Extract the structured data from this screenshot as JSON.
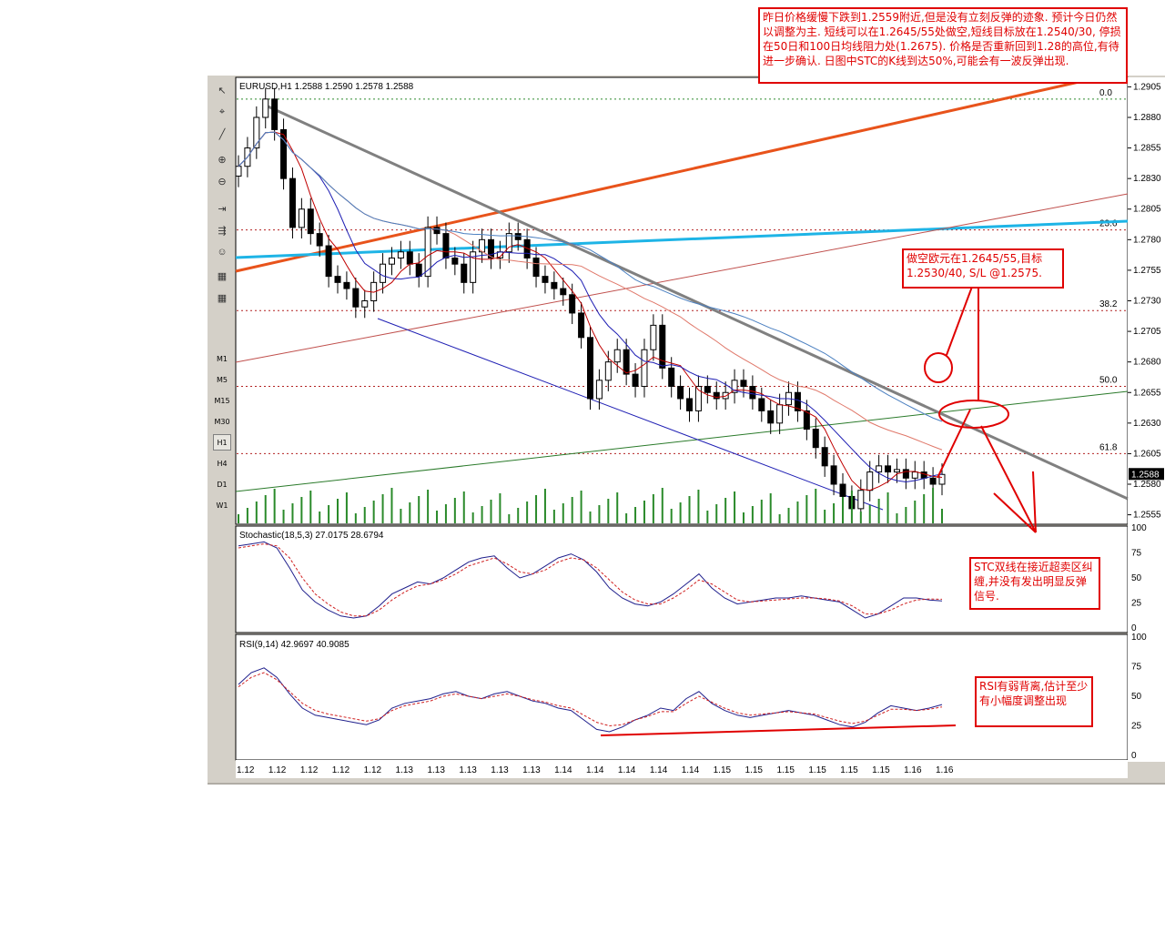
{
  "window": {
    "symbol_header": "EURUSD,H1  1.2588 1.2590 1.2578 1.2588"
  },
  "toolbar": {
    "tools": [
      "cursor-tool",
      "crosshair-tool",
      "zoom-in",
      "zoom-out",
      "chart-shift",
      "autoscroll",
      "expert",
      "template",
      "template2"
    ],
    "timeframes": [
      "M1",
      "M5",
      "M15",
      "M30",
      "H1",
      "H4",
      "D1",
      "W1"
    ],
    "active_timeframe": "H1"
  },
  "annotations": {
    "top_note": "昨日价格缓慢下跌到1.2559附近,但是没有立刻反弹的迹象. 预计今日仍然以调整为主. 短线可以在1.2645/55处做空,短线目标放在1.2540/30, 停损在50日和100日均线阻力处(1.2675). 价格是否重新回到1.28的高位,有待进一步确认. 日图中STC的K线到达50%,可能会有一波反弹出现.",
    "trade_note": "做空欧元在1.2645/55,目标1.2530/40, S/L @1.2575.",
    "stc_note": "STC双线在接近超卖区纠缠,并没有发出明显反弹信号.",
    "rsi_note": "RSI有弱背离,估计至少有小幅度调整出现"
  },
  "chart_data": [
    {
      "type": "candlestick",
      "title": "EURUSD,H1  1.2588 1.2590 1.2578 1.2588",
      "ylim": [
        1.2548,
        1.2912
      ],
      "y_ticks": [
        "1.2905",
        "1.2880",
        "1.2855",
        "1.2830",
        "1.2805",
        "1.2780",
        "1.2755",
        "1.2730",
        "1.2705",
        "1.2680",
        "1.2655",
        "1.2630",
        "1.2605",
        "1.2580",
        "1.2555"
      ],
      "last_price": "1.2588",
      "x_ticks": [
        "1.12",
        "1.12",
        "1.12",
        "1.12",
        "1.12",
        "1.13",
        "1.13",
        "1.13",
        "1.13",
        "1.13",
        "1.14",
        "1.14",
        "1.14",
        "1.14",
        "1.14",
        "1.15",
        "1.15",
        "1.15",
        "1.15",
        "1.15",
        "1.15",
        "1.16",
        "1.16"
      ],
      "closes": [
        1.284,
        1.2855,
        1.288,
        1.2895,
        1.287,
        1.283,
        1.279,
        1.2805,
        1.2785,
        1.2775,
        1.275,
        1.2745,
        1.274,
        1.2725,
        1.273,
        1.2745,
        1.276,
        1.2765,
        1.277,
        1.276,
        1.275,
        1.279,
        1.2785,
        1.2765,
        1.276,
        1.2745,
        1.277,
        1.278,
        1.2765,
        1.277,
        1.2785,
        1.278,
        1.2765,
        1.275,
        1.2745,
        1.274,
        1.2735,
        1.272,
        1.27,
        1.265,
        1.2665,
        1.268,
        1.269,
        1.267,
        1.266,
        1.269,
        1.271,
        1.2675,
        1.266,
        1.265,
        1.264,
        1.266,
        1.2655,
        1.265,
        1.2655,
        1.2665,
        1.266,
        1.265,
        1.264,
        1.263,
        1.2645,
        1.2655,
        1.264,
        1.2625,
        1.261,
        1.2595,
        1.258,
        1.257,
        1.256,
        1.2575,
        1.259,
        1.2595,
        1.259,
        1.2592,
        1.2585,
        1.259,
        1.2585,
        1.258,
        1.2588
      ],
      "horizontal_levels": [
        {
          "label": "0.0",
          "value": 1.2895
        },
        {
          "label": "23.6",
          "value": 1.2788
        },
        {
          "label": "38.2",
          "value": 1.2722
        },
        {
          "label": "50.0",
          "value": 1.266
        },
        {
          "label": "61.8",
          "value": 1.2605
        }
      ]
    },
    {
      "type": "line",
      "title": "Stochastic(18,5,3) 27.0175 28.6794",
      "ylim": [
        0,
        100
      ],
      "y_ticks": [
        "100",
        "75",
        "50",
        "25",
        "0"
      ],
      "series": [
        {
          "name": "%K",
          "values": [
            82,
            84,
            86,
            80,
            60,
            38,
            26,
            18,
            12,
            10,
            12,
            22,
            34,
            40,
            46,
            44,
            50,
            58,
            66,
            70,
            72,
            60,
            50,
            54,
            62,
            70,
            74,
            68,
            56,
            40,
            30,
            24,
            22,
            26,
            34,
            44,
            54,
            40,
            30,
            24,
            26,
            28,
            30,
            30,
            32,
            30,
            28,
            26,
            18,
            10,
            14,
            22,
            30,
            30,
            28,
            27
          ]
        },
        {
          "name": "%D",
          "values": [
            80,
            82,
            84,
            82,
            70,
            50,
            34,
            24,
            16,
            12,
            12,
            18,
            28,
            36,
            42,
            44,
            48,
            54,
            62,
            66,
            70,
            64,
            56,
            54,
            58,
            66,
            70,
            68,
            60,
            48,
            36,
            28,
            24,
            24,
            30,
            38,
            48,
            44,
            36,
            28,
            26,
            27,
            28,
            29,
            30,
            30,
            29,
            27,
            22,
            14,
            14,
            18,
            24,
            28,
            29,
            28.7
          ]
        }
      ]
    },
    {
      "type": "line",
      "title": "RSI(9,14) 42.9697 40.9085",
      "ylim": [
        0,
        100
      ],
      "y_ticks": [
        "100",
        "75",
        "50",
        "25",
        "0"
      ],
      "series": [
        {
          "name": "RSI(9)",
          "values": [
            60,
            70,
            74,
            66,
            52,
            40,
            34,
            32,
            30,
            28,
            26,
            30,
            40,
            44,
            46,
            48,
            52,
            54,
            50,
            48,
            52,
            54,
            50,
            46,
            44,
            40,
            38,
            30,
            22,
            20,
            24,
            30,
            34,
            40,
            38,
            48,
            54,
            44,
            38,
            34,
            32,
            34,
            36,
            38,
            36,
            34,
            30,
            26,
            24,
            28,
            36,
            42,
            40,
            38,
            40,
            43
          ]
        },
        {
          "name": "RSI(14)",
          "values": [
            58,
            66,
            70,
            64,
            54,
            44,
            38,
            35,
            33,
            31,
            29,
            31,
            38,
            42,
            44,
            46,
            50,
            52,
            50,
            48,
            50,
            52,
            50,
            47,
            45,
            42,
            40,
            34,
            28,
            25,
            26,
            30,
            33,
            37,
            37,
            44,
            50,
            45,
            40,
            36,
            34,
            35,
            36,
            37,
            36,
            35,
            32,
            29,
            27,
            29,
            34,
            39,
            39,
            38,
            39,
            41
          ]
        }
      ]
    }
  ]
}
